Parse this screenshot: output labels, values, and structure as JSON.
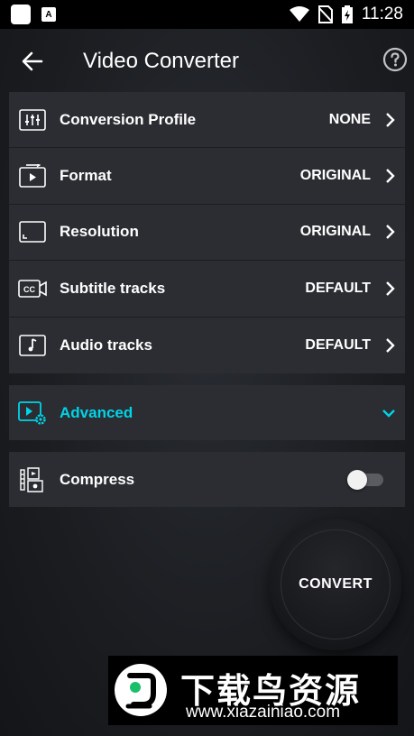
{
  "status_bar": {
    "time": "11:28",
    "icons": [
      "app-square-icon",
      "app-a-icon",
      "wifi-icon",
      "no-sim-icon",
      "battery-charging-icon"
    ],
    "app_a_letter": "A"
  },
  "header": {
    "title": "Video Converter",
    "back_icon": "arrow-left-icon",
    "help_icon": "help-circle-icon"
  },
  "settings": [
    {
      "icon": "equalizer-icon",
      "label": "Conversion Profile",
      "value": "NONE"
    },
    {
      "icon": "format-play-icon",
      "label": "Format",
      "value": "ORIGINAL"
    },
    {
      "icon": "resolution-icon",
      "label": "Resolution",
      "value": "ORIGINAL"
    },
    {
      "icon": "cc-subtitle-icon",
      "label": "Subtitle tracks",
      "value": "DEFAULT"
    },
    {
      "icon": "audio-note-icon",
      "label": "Audio tracks",
      "value": "DEFAULT"
    }
  ],
  "advanced": {
    "label": "Advanced",
    "icon": "video-settings-icon",
    "expand_icon": "chevron-down-icon"
  },
  "compress": {
    "label": "Compress",
    "icon": "compress-icon",
    "enabled": false
  },
  "convert_button": {
    "label": "CONVERT"
  },
  "watermark": {
    "title": "下载鸟资源",
    "url": "www.xiazainiao.com"
  },
  "colors": {
    "accent": "#00d4e8",
    "card": "#2b2d32",
    "background": "#1b1d21"
  }
}
